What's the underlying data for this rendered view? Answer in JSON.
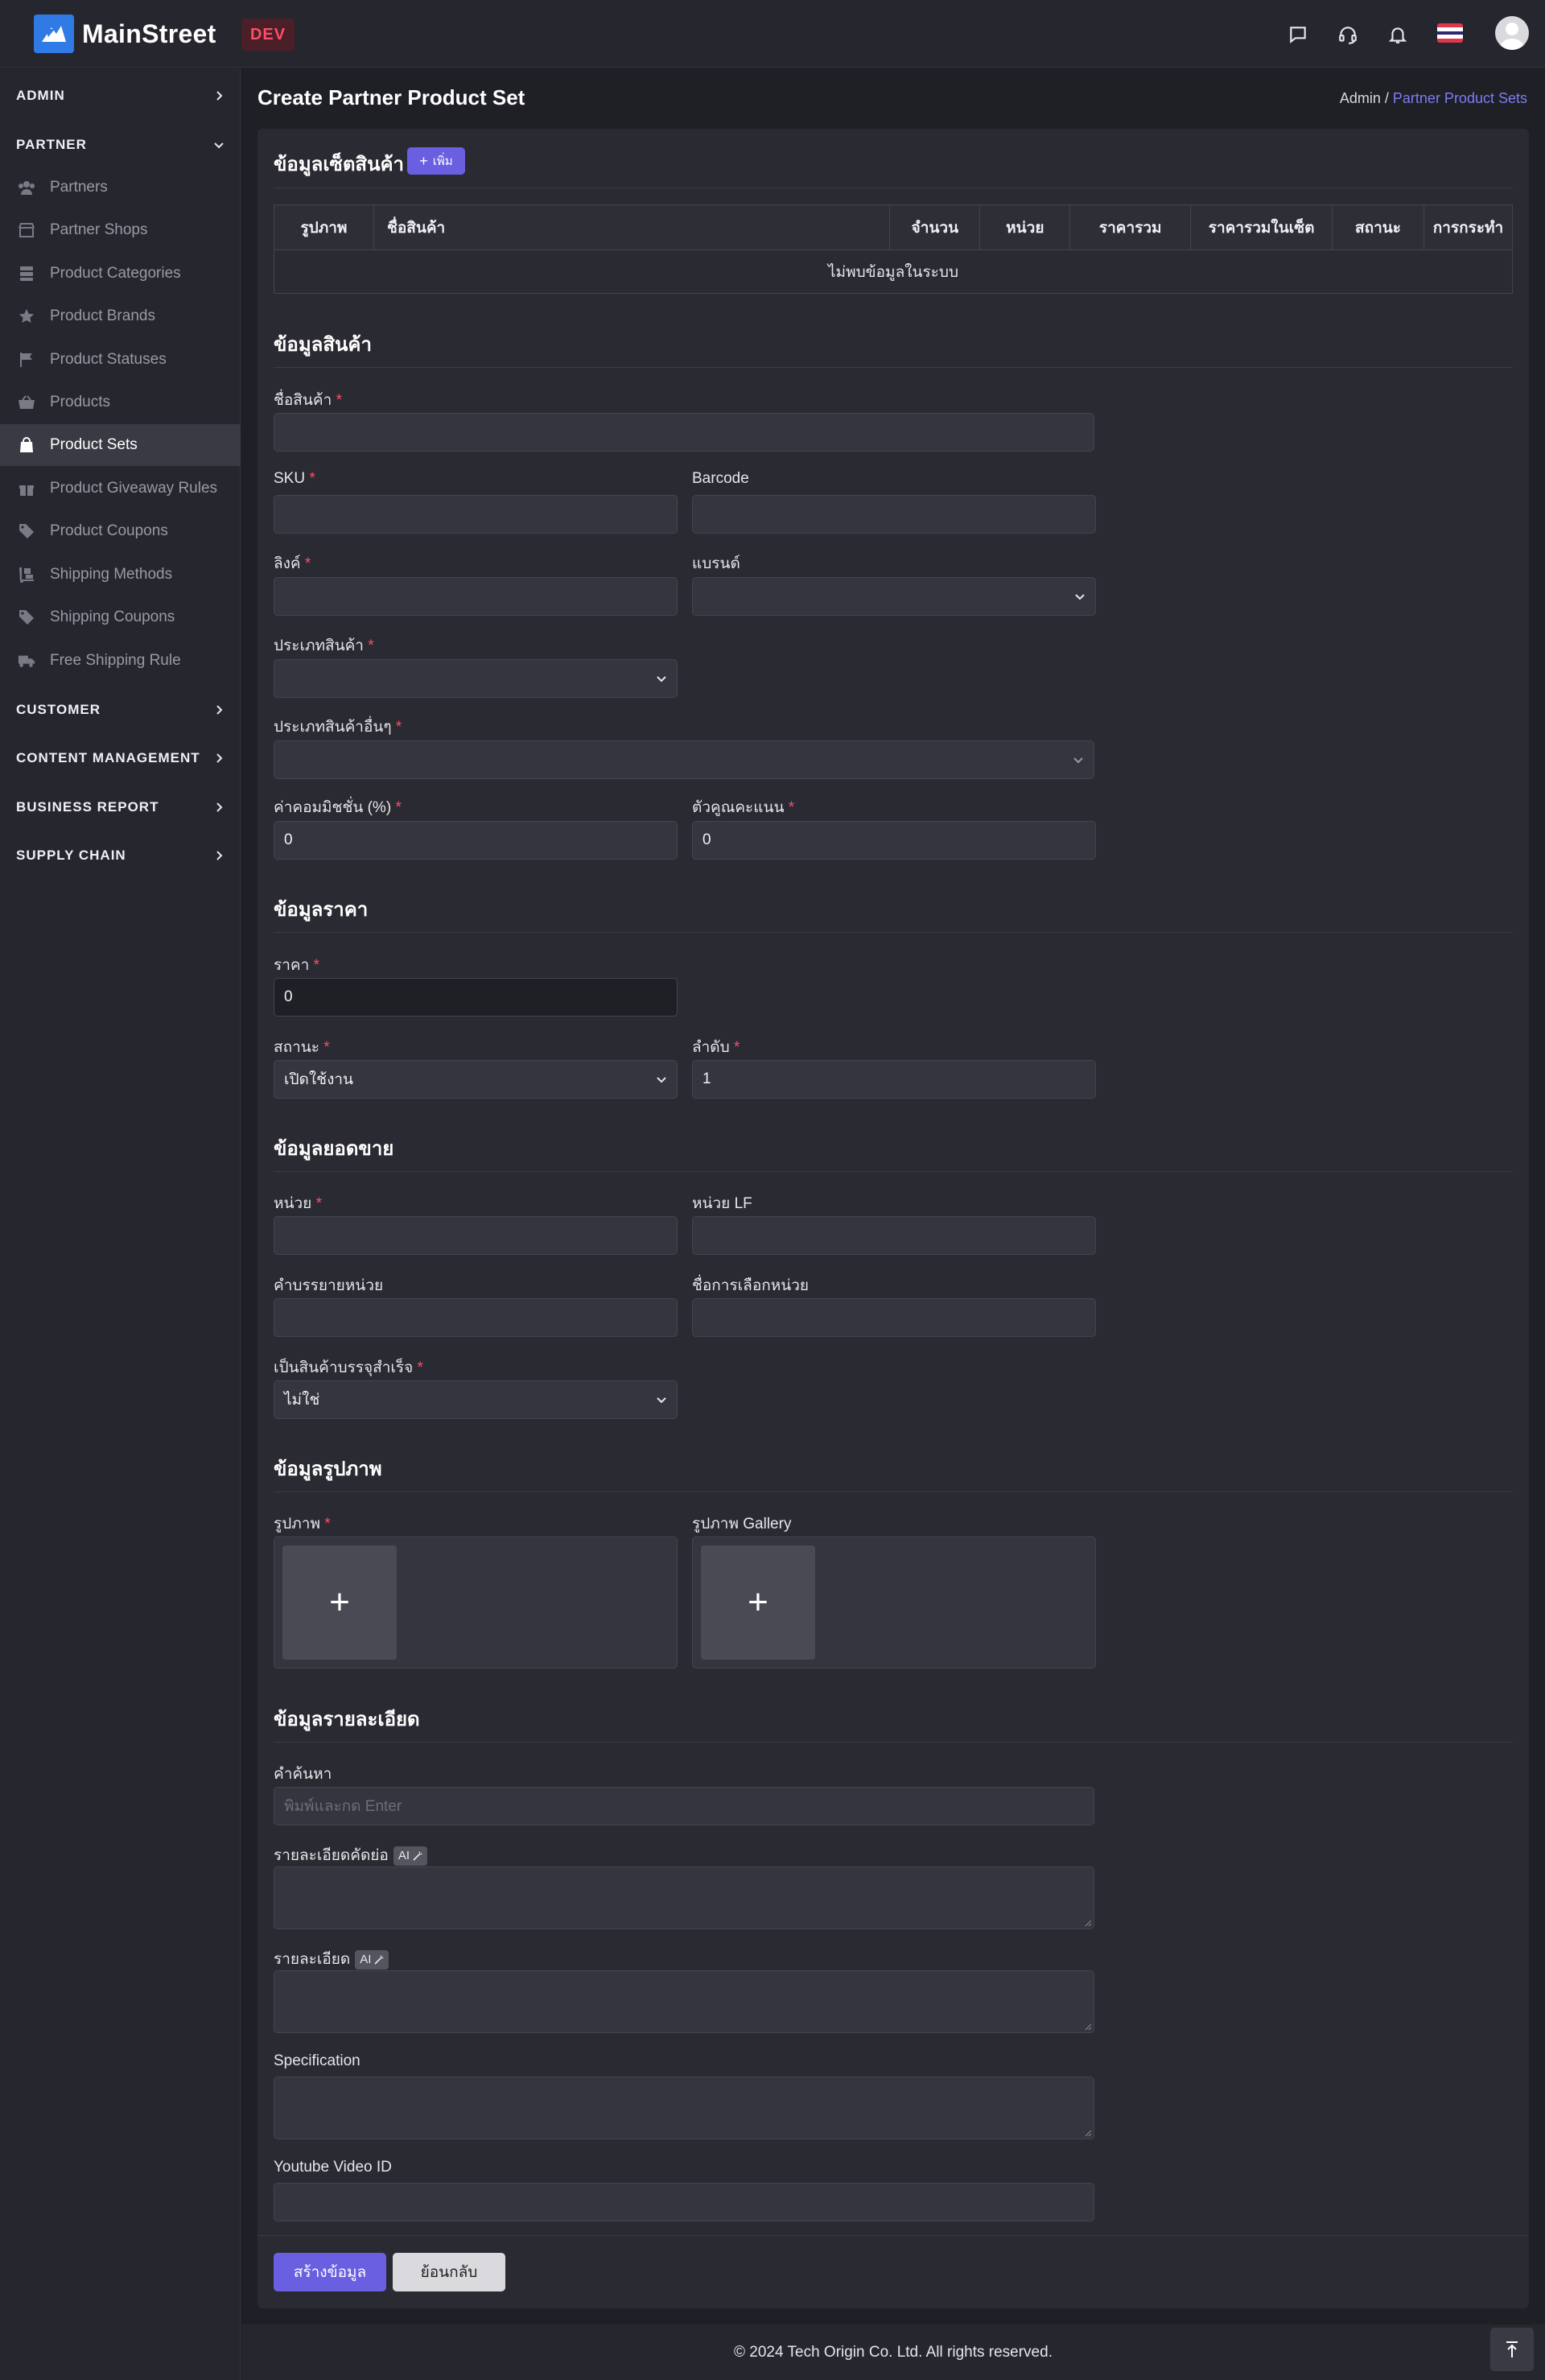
{
  "header": {
    "app_name": "MainStreet",
    "env_badge": "DEV",
    "icons": [
      "chat-icon",
      "headset-icon",
      "bell-icon",
      "thai-flag-icon",
      "avatar"
    ]
  },
  "sidebar": {
    "groups": [
      {
        "label": "ADMIN"
      },
      {
        "label": "PARTNER"
      },
      {
        "label": "CUSTOMER"
      },
      {
        "label": "CONTENT MANAGEMENT"
      },
      {
        "label": "BUSINESS REPORT"
      },
      {
        "label": "SUPPLY CHAIN"
      }
    ],
    "partner_items": [
      {
        "label": "Partners",
        "icon": "users-icon"
      },
      {
        "label": "Partner Shops",
        "icon": "store-icon"
      },
      {
        "label": "Product Categories",
        "icon": "layers-icon"
      },
      {
        "label": "Product Brands",
        "icon": "star-icon"
      },
      {
        "label": "Product Statuses",
        "icon": "flag-icon"
      },
      {
        "label": "Products",
        "icon": "basket-icon"
      },
      {
        "label": "Product Sets",
        "icon": "bag-icon",
        "active": true
      },
      {
        "label": "Product Giveaway Rules",
        "icon": "gift-icon"
      },
      {
        "label": "Product Coupons",
        "icon": "tag-icon"
      },
      {
        "label": "Shipping Methods",
        "icon": "dolly-icon"
      },
      {
        "label": "Shipping Coupons",
        "icon": "tag-icon"
      },
      {
        "label": "Free Shipping Rule",
        "icon": "truck-icon"
      }
    ]
  },
  "page": {
    "title": "Create Partner Product Set",
    "breadcrumb": {
      "root": "Admin",
      "separator": " / ",
      "current": "Partner Product Sets"
    }
  },
  "set_section": {
    "title": "ข้อมูลเซ็ตสินค้า",
    "add_label": "เพิ่ม",
    "table": {
      "columns": [
        "รูปภาพ",
        "ชื่อสินค้า",
        "จำนวน",
        "หน่วย",
        "ราคารวม",
        "ราคารวมในเซ็ต",
        "สถานะ",
        "การกระทำ"
      ],
      "empty_text": "ไม่พบข้อมูลในระบบ"
    }
  },
  "product_section": {
    "title": "ข้อมูลสินค้า",
    "name_label": "ชื่อสินค้า",
    "sku_label": "SKU",
    "barcode_label": "Barcode",
    "link_label": "ลิงค์",
    "brand_label": "แบรนด์",
    "category_label": "ประเภทสินค้า",
    "other_category_label": "ประเภทสินค้าอื่นๆ",
    "commission_label": "ค่าคอมมิชชั่น (%)",
    "commission_value": "0",
    "multiplier_label": "ตัวคูณคะแนน",
    "multiplier_value": "0"
  },
  "price_section": {
    "title": "ข้อมูลราคา",
    "price_label": "ราคา",
    "price_value": "0",
    "status_label": "สถานะ",
    "status_value": "เปิดใช้งาน",
    "order_label": "ลำดับ",
    "order_value": "1"
  },
  "sales_section": {
    "title": "ข้อมูลยอดขาย",
    "unit_label": "หน่วย",
    "unit_lf_label": "หน่วย LF",
    "unit_desc_label": "คำบรรยายหน่วย",
    "unit_choice_label": "ชื่อการเลือกหน่วย",
    "packaged_label": "เป็นสินค้าบรรจุสำเร็จ",
    "packaged_value": "ไม่ใช่"
  },
  "image_section": {
    "title": "ข้อมูลรูปภาพ",
    "image_label": "รูปภาพ",
    "gallery_label": "รูปภาพ Gallery",
    "add_symbol": "+"
  },
  "detail_section": {
    "title": "ข้อมูลรายละเอียด",
    "keywords_label": "คำค้นหา",
    "keywords_placeholder": "พิมพ์และกด Enter",
    "short_desc_label": "รายละเอียดคัดย่อ",
    "desc_label": "รายละเอียด",
    "ai_label": "AI",
    "spec_label": "Specification",
    "youtube_label": "Youtube Video ID"
  },
  "actions": {
    "create_label": "สร้างข้อมูล",
    "back_label": "ย้อนกลับ"
  },
  "footer": {
    "copyright": "© 2024 Tech Origin Co. Ltd. All rights reserved."
  },
  "colors": {
    "accent": "#6a5fe0",
    "required": "#ff4d6a",
    "link": "#7b7ef2",
    "background": "#1f1f26",
    "card": "#2a2a32"
  }
}
